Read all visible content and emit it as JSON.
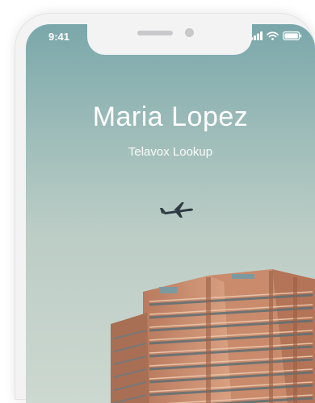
{
  "status_bar": {
    "time": "9:41",
    "icons": [
      "cellular-signal-icon",
      "wifi-icon",
      "battery-icon"
    ]
  },
  "header": {
    "name": "Maria Lopez",
    "app_name": "Telavox Lookup"
  },
  "background": {
    "sky_color_top": "#7aa7aa",
    "sky_color_bottom": "#ccd8d0",
    "building_color": "#c9906f"
  }
}
